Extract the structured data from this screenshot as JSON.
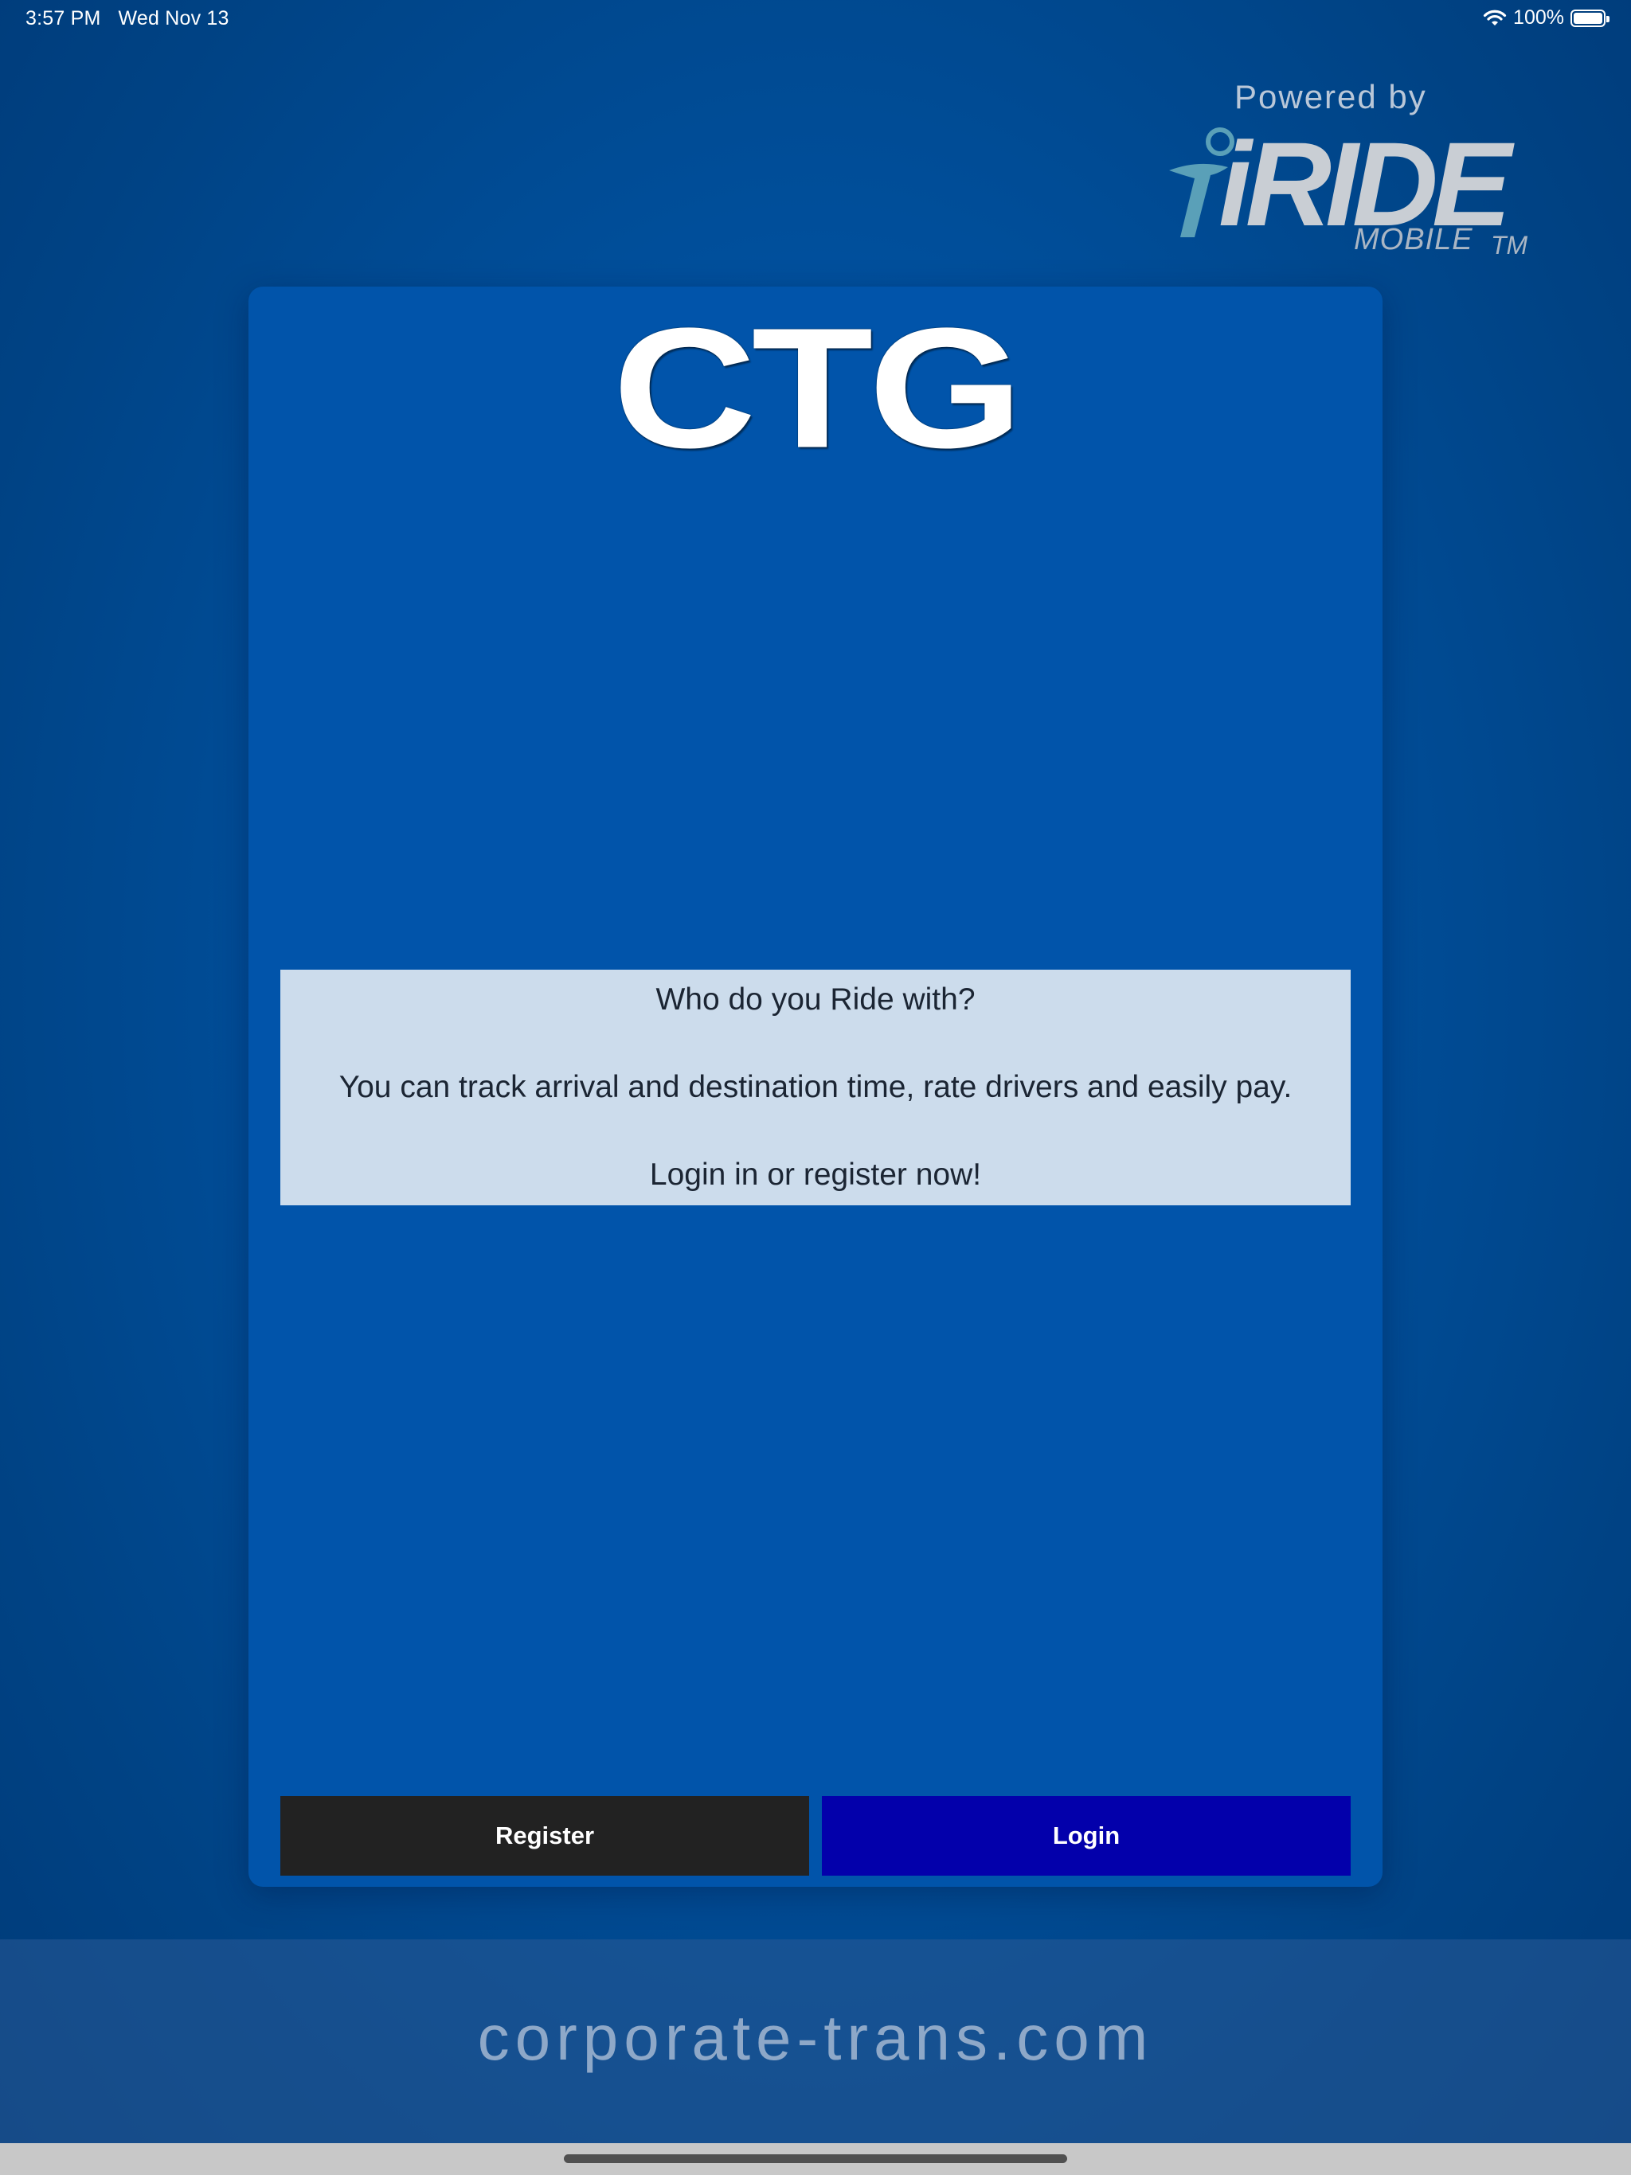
{
  "status_bar": {
    "time": "3:57 PM",
    "date": "Wed Nov 13",
    "battery_percent": "100%",
    "battery_level": 1.0,
    "icons": [
      "wifi-icon",
      "battery-icon"
    ]
  },
  "powered_by": {
    "label": "Powered by",
    "brand": "iRIDE",
    "sub": "MOBILE",
    "tm": "TM"
  },
  "card": {
    "logo_text": "CTG",
    "info": {
      "line1": "Who do you Ride with?",
      "line2": "You can track arrival and destination time, rate drivers and easily pay.",
      "line3": "Login in or register now!"
    },
    "buttons": {
      "register": "Register",
      "login": "Login"
    }
  },
  "footer": {
    "url": "corporate-trans.com"
  },
  "colors": {
    "background": "#0052a1",
    "card": "#0154aa",
    "info_box": "#ccdcec",
    "register_button": "#222222",
    "login_button": "#0300ab"
  }
}
